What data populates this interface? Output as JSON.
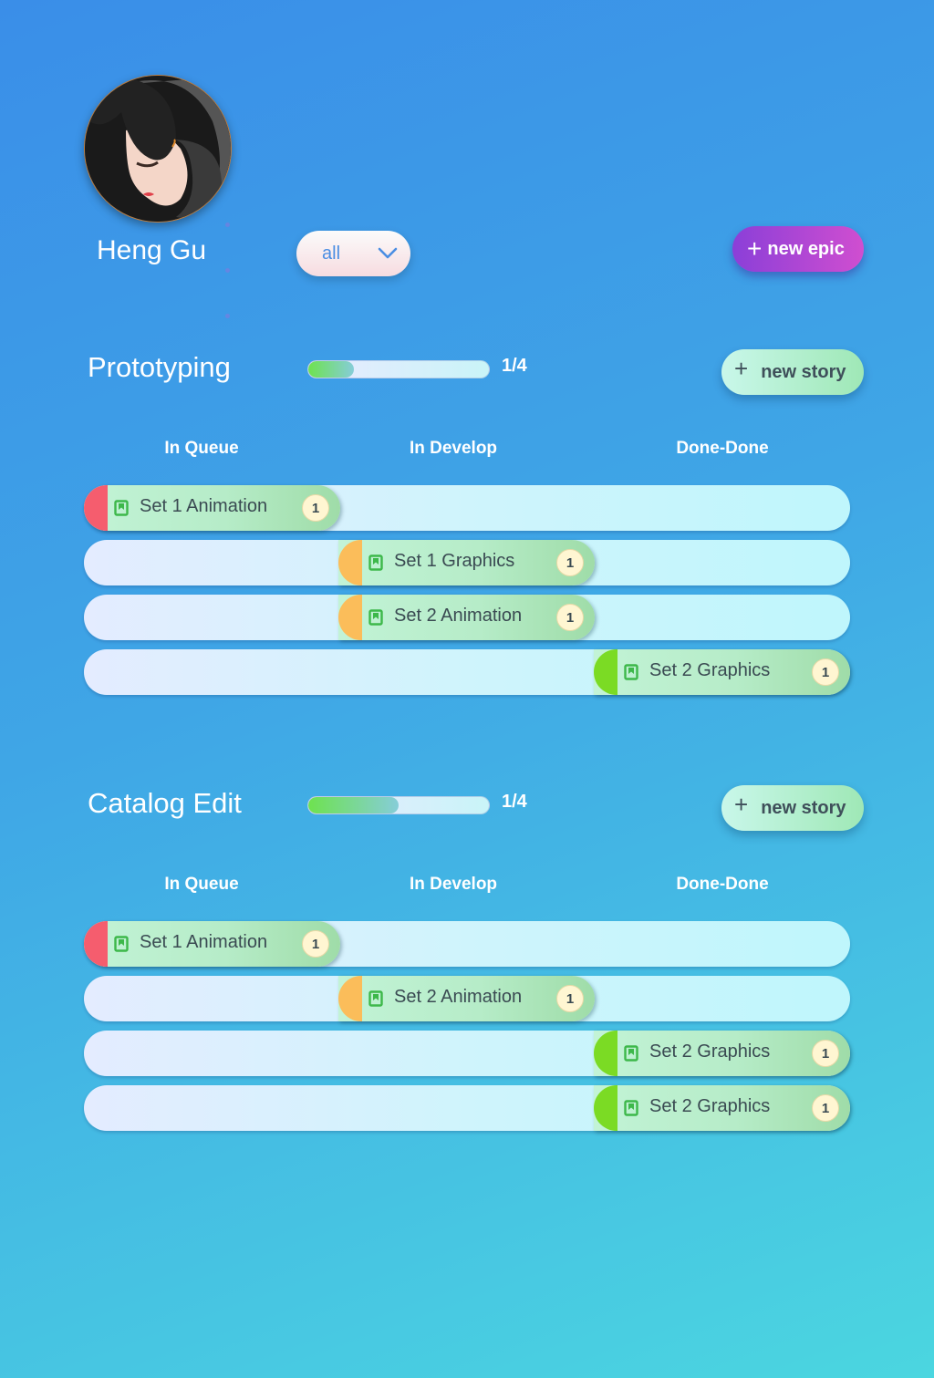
{
  "user": {
    "name": "Heng Gu",
    "avatar_icon": "user-avatar-icon"
  },
  "filter": {
    "value": "all",
    "icon": "chevron-down-icon"
  },
  "new_epic": {
    "label": "new epic",
    "icon": "plus-icon"
  },
  "colors": {
    "queue": "#f55d6e",
    "develop": "#fbbd5a",
    "done": "#7bdb24",
    "accent": "#b543d6"
  },
  "epics": [
    {
      "title": "Prototyping",
      "progress_text": "1/4",
      "progress": 0.25,
      "new_story_label": "new story",
      "columns": [
        "In Queue",
        "In Develop",
        "Done-Done"
      ],
      "stories": [
        {
          "label": "Set 1 Animation",
          "count": "1",
          "stage": 0,
          "icon": "bookmark-icon"
        },
        {
          "label": "Set 1 Graphics",
          "count": "1",
          "stage": 1,
          "icon": "bookmark-icon"
        },
        {
          "label": "Set 2 Animation",
          "count": "1",
          "stage": 1,
          "icon": "bookmark-icon"
        },
        {
          "label": "Set 2 Graphics",
          "count": "1",
          "stage": 2,
          "icon": "bookmark-icon"
        }
      ]
    },
    {
      "title": "Catalog Edit",
      "progress_text": "1/4",
      "progress": 0.5,
      "new_story_label": "new story",
      "columns": [
        "In Queue",
        "In Develop",
        "Done-Done"
      ],
      "stories": [
        {
          "label": "Set 1 Animation",
          "count": "1",
          "stage": 0,
          "icon": "bookmark-icon"
        },
        {
          "label": "Set 2 Animation",
          "count": "1",
          "stage": 1,
          "icon": "bookmark-icon"
        },
        {
          "label": "Set 2 Graphics",
          "count": "1",
          "stage": 2,
          "icon": "bookmark-icon"
        },
        {
          "label": "Set 2 Graphics",
          "count": "1",
          "stage": 2,
          "icon": "bookmark-icon"
        }
      ]
    }
  ]
}
